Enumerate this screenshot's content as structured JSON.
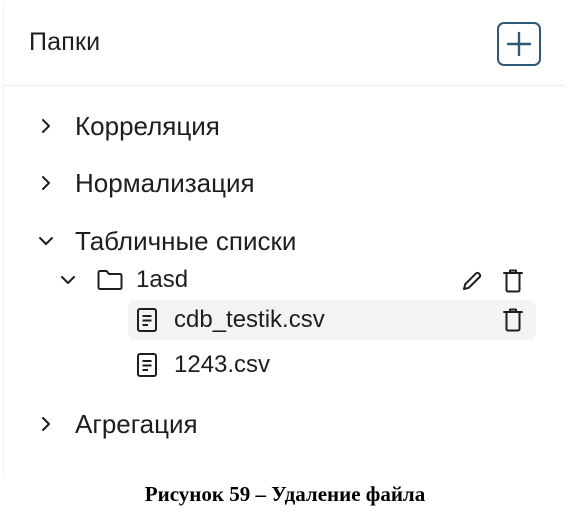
{
  "header": {
    "title": "Папки",
    "add_icon": "plus-icon"
  },
  "tree": {
    "folders": [
      {
        "label": "Корреляция",
        "expanded": false
      },
      {
        "label": "Нормализация",
        "expanded": false
      },
      {
        "label": "Табличные списки",
        "expanded": true
      },
      {
        "label": "Агрегация",
        "expanded": false
      }
    ],
    "subfolder": {
      "label": "1asd",
      "expanded": true,
      "files": [
        {
          "label": "cdb_testik.csv",
          "selected": true
        },
        {
          "label": "1243.csv",
          "selected": false
        }
      ]
    }
  },
  "caption": "Рисунок 59 – Удаление файла",
  "colors": {
    "accent": "#2f5877",
    "selected_row": "#f2f3f5",
    "text": "#1e1e1e"
  }
}
